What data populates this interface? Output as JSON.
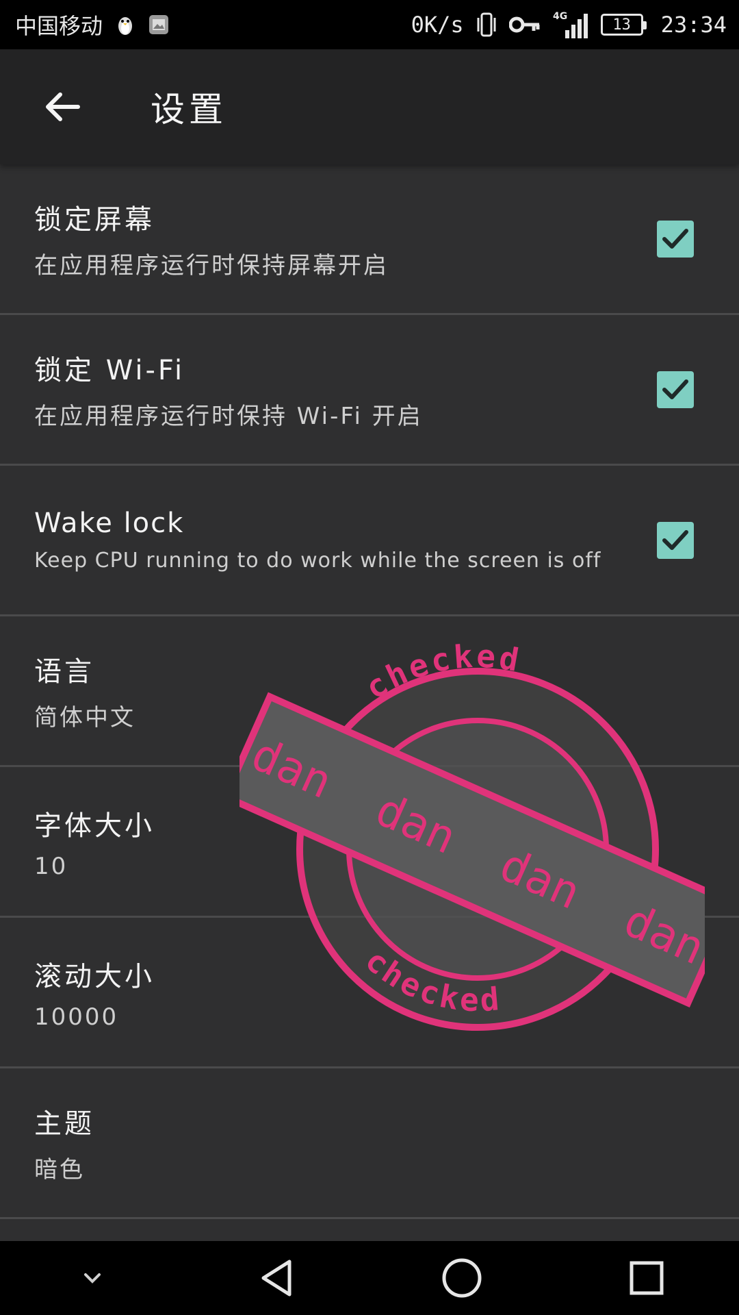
{
  "status_bar": {
    "carrier": "中国移动",
    "net_speed": "0K/s",
    "network": "4G",
    "battery": "13",
    "time": "23:34"
  },
  "app_bar": {
    "title": "设置",
    "back_icon": "arrow-left-icon"
  },
  "settings": [
    {
      "title": "锁定屏幕",
      "summary": "在应用程序运行时保持屏幕开启",
      "checked": true
    },
    {
      "title": "锁定 Wi-Fi",
      "summary": "在应用程序运行时保持 Wi-Fi 开启",
      "checked": true
    },
    {
      "title": "Wake lock",
      "summary": "Keep CPU running to do work while the screen is off",
      "checked": true
    },
    {
      "title": "语言",
      "summary": "简体中文"
    },
    {
      "title": "字体大小",
      "summary": "10"
    },
    {
      "title": "滚动大小",
      "summary": "10000"
    },
    {
      "title": "主题",
      "summary": "暗色"
    }
  ],
  "stamp": {
    "band_text": "dan  dan  dan  dan",
    "ring_text": "checked",
    "color": "#e0337a"
  },
  "colors": {
    "checkbox": "#7fcfc2",
    "background": "#2f2f30",
    "app_bar": "#232324"
  },
  "nav_bar": {
    "icons": [
      "chevron-down-icon",
      "back-triangle-icon",
      "home-circle-icon",
      "recents-square-icon"
    ]
  }
}
